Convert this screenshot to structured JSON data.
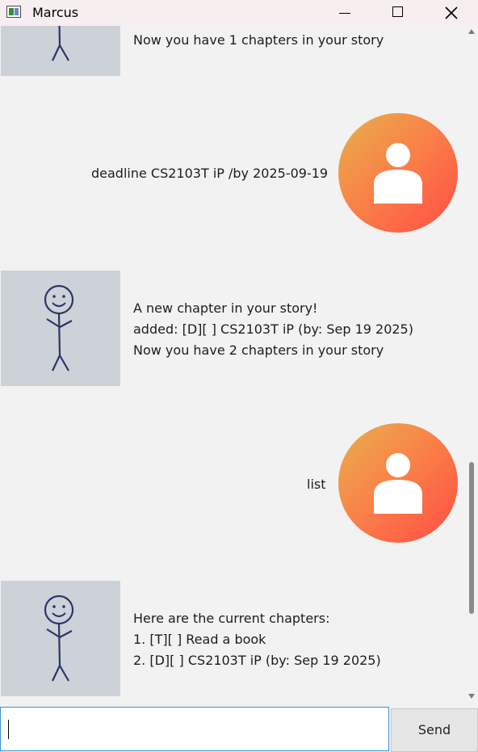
{
  "window": {
    "title": "Marcus",
    "app_icon": "app-window-icon",
    "controls": [
      "minimize-icon",
      "maximize-icon",
      "close-icon"
    ]
  },
  "conversation": [
    {
      "sender": "duke",
      "lines": [
        "Now you have 1 chapters in your story"
      ]
    },
    {
      "sender": "user",
      "lines": [
        "deadline CS2103T iP /by 2025-09-19"
      ]
    },
    {
      "sender": "duke",
      "lines": [
        "A new chapter in your story!",
        "added: [D][ ] CS2103T iP (by: Sep 19 2025)",
        "Now you have 2 chapters in your story"
      ]
    },
    {
      "sender": "user",
      "lines": [
        "list"
      ]
    },
    {
      "sender": "duke",
      "lines": [
        "Here are the current chapters:",
        "1. [T][ ] Read a book",
        "2. [D][ ] CS2103T iP (by: Sep 19 2025)"
      ]
    }
  ],
  "input": {
    "value": "",
    "placeholder": ""
  },
  "send_button": {
    "label": "Send"
  },
  "colors": {
    "user_avatar_gradient": [
      "#e8b04b",
      "#ff4d45"
    ],
    "duke_avatar_bg": "#cdd2d9",
    "input_focus_border": "#3a93d4"
  }
}
